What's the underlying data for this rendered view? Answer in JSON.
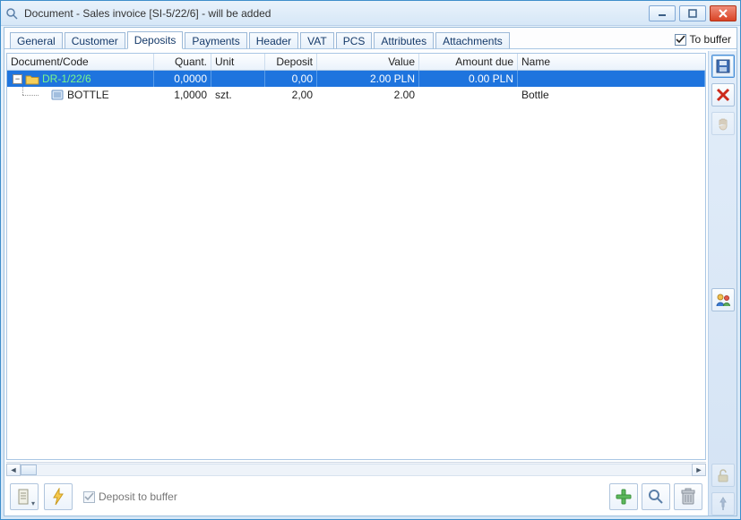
{
  "window": {
    "title": "Document - Sales invoice [SI-5/22/6]  - will be added"
  },
  "tabs": [
    "General",
    "Customer",
    "Deposits",
    "Payments",
    "Header",
    "VAT",
    "PCS",
    "Attributes",
    "Attachments"
  ],
  "active_tab": "Deposits",
  "tobuffer": {
    "label": "To buffer",
    "checked": true
  },
  "columns": {
    "doc": "Document/Code",
    "quant": "Quant.",
    "unit": "Unit",
    "deposit": "Deposit",
    "value": "Value",
    "amount": "Amount due",
    "name": "Name"
  },
  "rows": [
    {
      "label": "DR-1/22/6",
      "quant": "0,0000",
      "unit": "",
      "deposit": "0,00",
      "value": "2.00 PLN",
      "amount": "0.00 PLN",
      "name": "",
      "selected": true,
      "expandable": true
    },
    {
      "label": "BOTTLE",
      "quant": "1,0000",
      "unit": "szt.",
      "deposit": "2,00",
      "value": "2.00",
      "amount": "",
      "name": "Bottle",
      "child": true
    }
  ],
  "deposit_to_buffer": {
    "label": "Deposit to buffer",
    "checked": true
  }
}
